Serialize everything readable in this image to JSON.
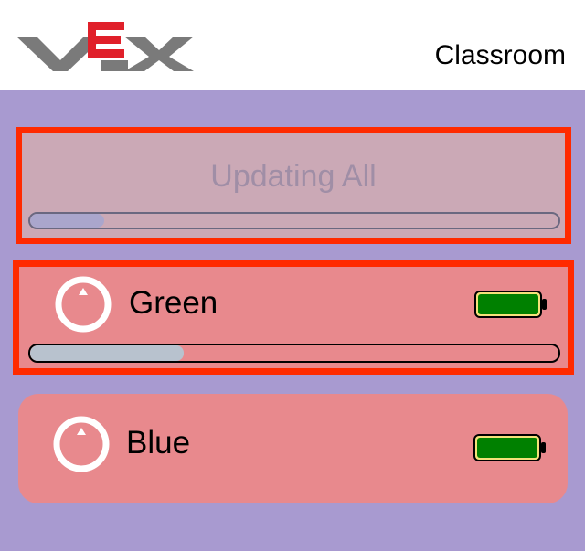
{
  "header": {
    "logo_text": "VEX",
    "title": "Classroom"
  },
  "update_all": {
    "label": "Updating All",
    "progress": 0.14
  },
  "robots": [
    {
      "name": "Green",
      "progress": 0.29,
      "battery_level": 1.0,
      "selected": true
    },
    {
      "name": "Blue",
      "battery_level": 1.0,
      "selected": false
    }
  ],
  "icons": {
    "robot": "robot-brain-icon",
    "battery": "battery-full-icon"
  },
  "colors": {
    "background": "#a89ad0",
    "header_bg": "#ffffff",
    "card": "#e8898d",
    "selected_border": "#ff2a00",
    "battery_fill": "#008000",
    "logo_gray": "#7a7a7a",
    "logo_red": "#e0202a"
  }
}
